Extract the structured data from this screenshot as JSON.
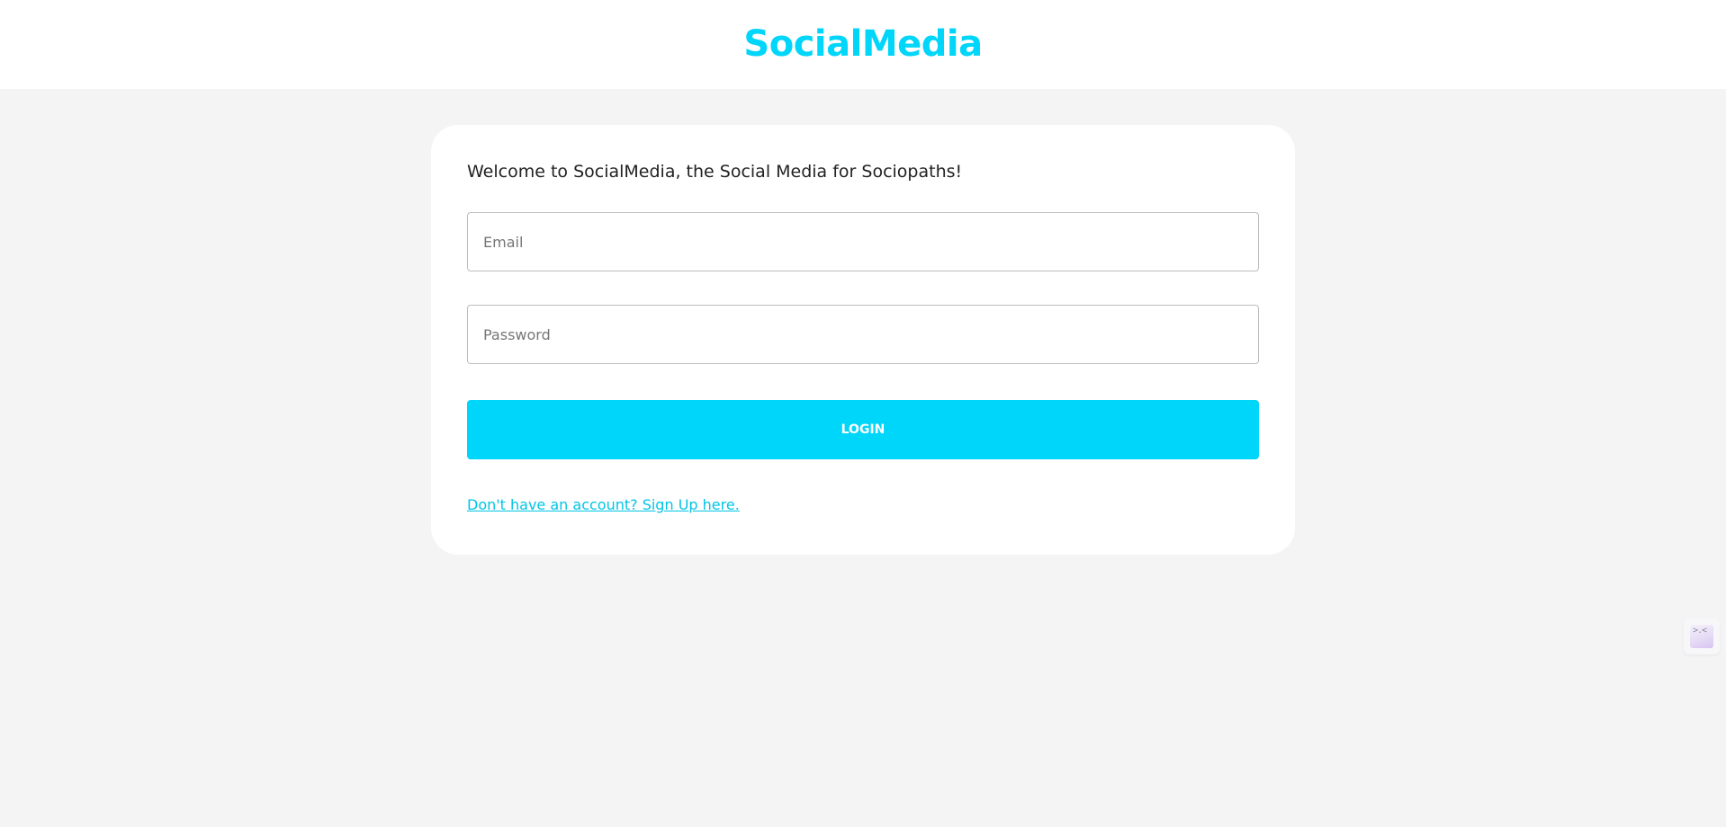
{
  "header": {
    "brand": "SocialMedia"
  },
  "login_card": {
    "welcome": "Welcome to SocialMedia, the Social Media for Sociopaths!",
    "email_placeholder": "Email",
    "password_placeholder": "Password",
    "login_label": "LOGIN",
    "signup_link": "Don't have an account? Sign Up here."
  },
  "side_widget": {
    "icon": "terminal-face-icon",
    "glyph": ">.<"
  },
  "colors": {
    "accent": "#00d5fa",
    "page_background": "#f4f4f4",
    "card_background": "#ffffff",
    "text": "#222222"
  }
}
